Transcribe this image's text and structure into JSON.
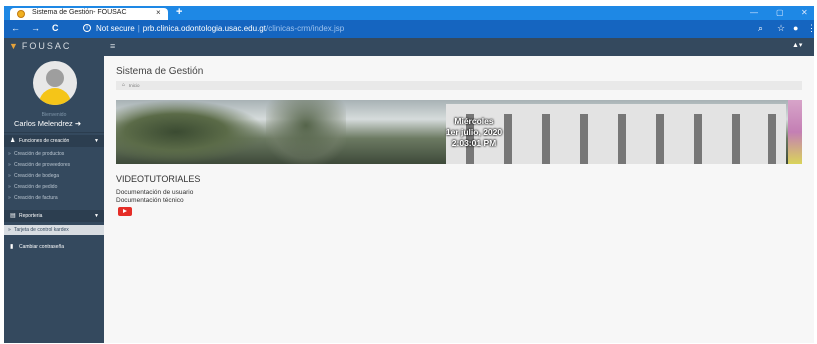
{
  "browser": {
    "tab_title": "Sistema de Gestión- FOUSAC",
    "tab_close": "×",
    "new_tab": "+",
    "window_controls": [
      "—",
      "▢",
      "✕"
    ],
    "nav_back": "←",
    "nav_forward": "→",
    "nav_reload": "C",
    "security_label": "Not secure",
    "url_host": "prb.clinica.odontologia.usac.edu.gt",
    "url_path": "/clinicas-crm/index.jsp"
  },
  "navbar": {
    "brand": "FOUSAC",
    "user_menu": "▲▾"
  },
  "sidebar": {
    "welcome": "Bienvenido",
    "username": "Carlos Melendrez",
    "sections": [
      {
        "label": "Funciones de creación",
        "items": [
          {
            "label": "Creación de productos"
          },
          {
            "label": "Creación de proveedores"
          },
          {
            "label": "Creación de bodega"
          },
          {
            "label": "Creación de pedido"
          },
          {
            "label": "Creación de factura"
          }
        ]
      },
      {
        "label": "Reporteria",
        "items": [
          {
            "label": "Tarjeta de control kardex"
          }
        ]
      }
    ],
    "change_password": "Cambiar contraseña"
  },
  "main": {
    "title": "Sistema de Gestión",
    "breadcrumb": "Inicio",
    "banner": {
      "day": "Miércoles",
      "date": "1er julio, 2020",
      "time": "2:03:01 PM"
    },
    "section_title": "VIDEOTUTORIALES",
    "links": [
      {
        "label": "Documentación de usuario"
      },
      {
        "label": "Documentación técnico"
      }
    ]
  },
  "colors": {
    "browser_tabstrip": "#1e88e5",
    "browser_toolbar": "#1565c0",
    "sidebar_bg": "#34495e",
    "video_icon": "#e52d27"
  }
}
